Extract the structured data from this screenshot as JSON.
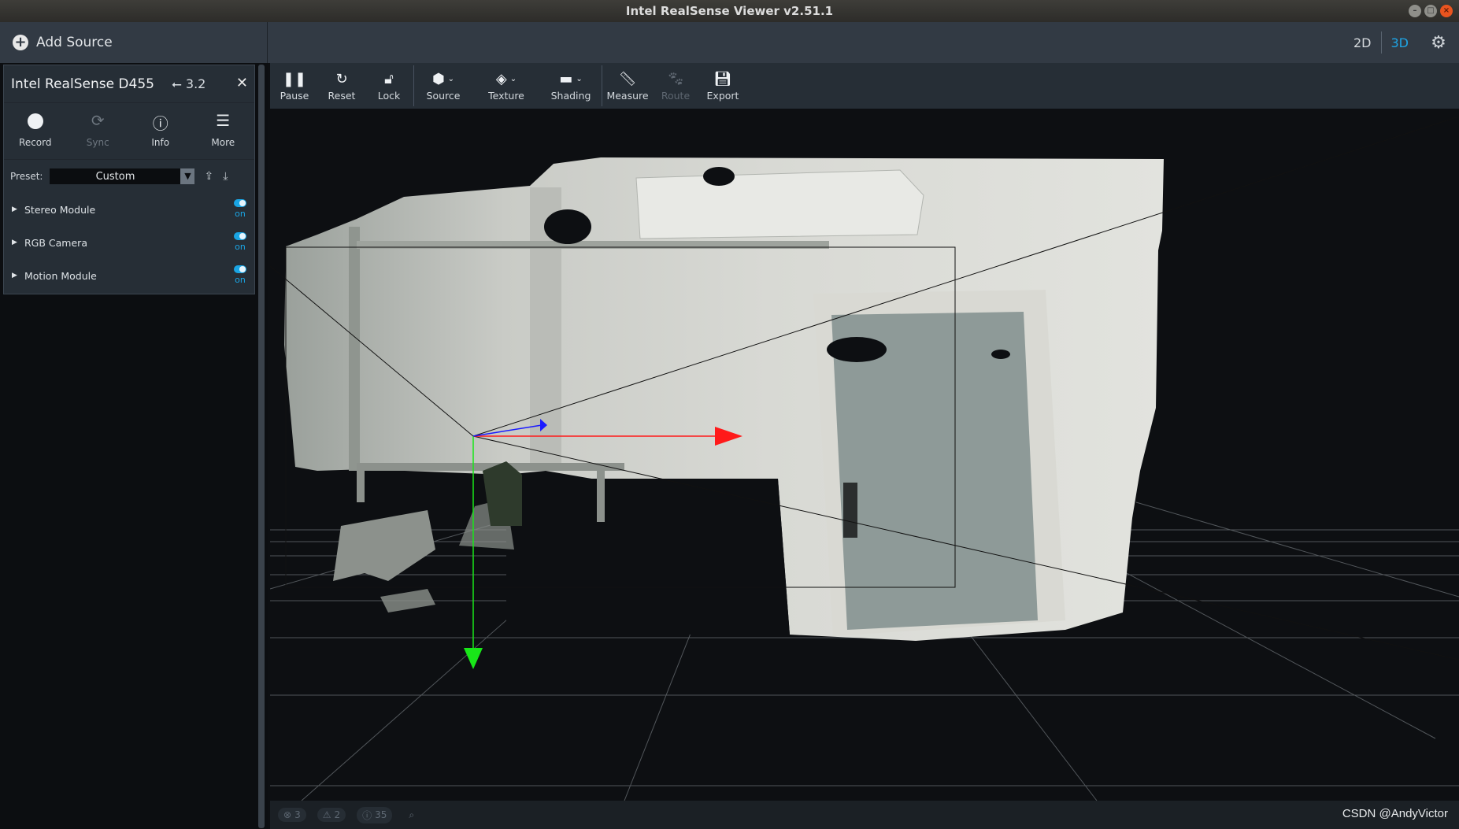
{
  "window": {
    "title": "Intel RealSense Viewer v2.51.1"
  },
  "topbar": {
    "add_source_label": "Add Source",
    "view_2d": "2D",
    "view_3d": "3D",
    "active_view": "3D"
  },
  "device": {
    "name": "Intel RealSense D455",
    "usb_version": "3.2",
    "buttons": [
      {
        "label": "Record",
        "icon": "record-icon",
        "enabled": true
      },
      {
        "label": "Sync",
        "icon": "sync-icon",
        "enabled": false
      },
      {
        "label": "Info",
        "icon": "info-icon",
        "enabled": true
      },
      {
        "label": "More",
        "icon": "menu-icon",
        "enabled": true
      }
    ],
    "preset_label": "Preset:",
    "preset_value": "Custom",
    "modules": [
      {
        "name": "Stereo Module",
        "state": "on"
      },
      {
        "name": "RGB Camera",
        "state": "on"
      },
      {
        "name": "Motion Module",
        "state": "on"
      }
    ]
  },
  "toolbar": {
    "items": [
      {
        "label": "Pause",
        "icon": "pause-icon",
        "enabled": true
      },
      {
        "label": "Reset",
        "icon": "reset-icon",
        "enabled": true
      },
      {
        "label": "Lock",
        "icon": "lock-icon",
        "enabled": true
      },
      {
        "label": "Source",
        "icon": "cube-icon",
        "enabled": true
      },
      {
        "label": "Texture",
        "icon": "paint-bucket-icon",
        "enabled": true
      },
      {
        "label": "Shading",
        "icon": "paint-roller-icon",
        "enabled": true
      },
      {
        "label": "Measure",
        "icon": "ruler-icon",
        "enabled": true
      },
      {
        "label": "Route",
        "icon": "paw-icon",
        "enabled": false
      },
      {
        "label": "Export",
        "icon": "save-icon",
        "enabled": true
      }
    ]
  },
  "status": {
    "errors": "3",
    "warnings": "2",
    "info": "35",
    "watermark": "CSDN @AndyVictor"
  },
  "colors": {
    "accent": "#1ea5e6",
    "axis_x": "#ff1a1a",
    "axis_y": "#19e619",
    "axis_z": "#1a1aff"
  }
}
